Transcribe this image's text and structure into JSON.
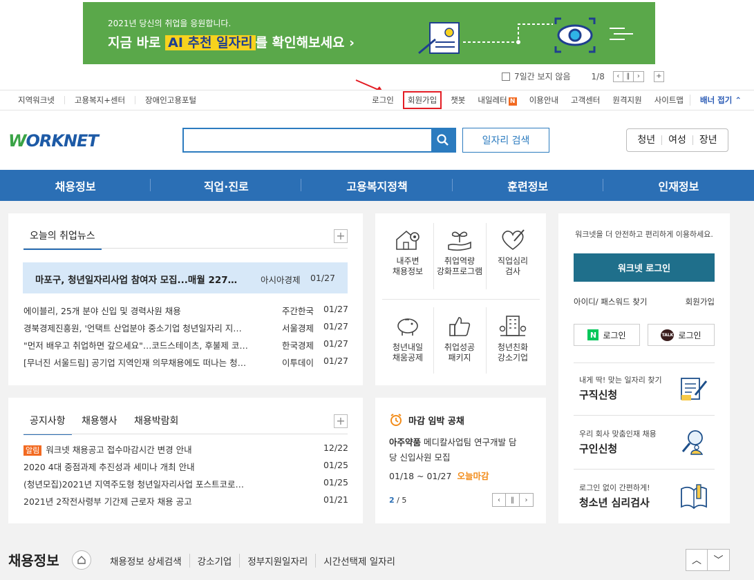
{
  "banner": {
    "sub": "2021년 당신의 취업을 응원합니다.",
    "main_pre": "지금 바로 ",
    "main_hl": "AI 추천 일자리",
    "main_post": "를 확인해보세요 ›",
    "hide_7days": "7일간 보지 않음",
    "page": "1/8"
  },
  "topbar": {
    "left": [
      "지역워크넷",
      "고용복지+센터",
      "장애인고용포털"
    ],
    "login": "로그인",
    "join": "회원가입",
    "chatbot": "챗봇",
    "naeil": "내일레터",
    "naeil_badge": "N",
    "guide": "이용안내",
    "cs": "고객센터",
    "remote": "원격지원",
    "sitemap": "사이트맵",
    "banner_toggle": "배너 접기"
  },
  "header": {
    "logo_w": "W",
    "logo_rest": "ORKNET",
    "job_search": "일자리 검색",
    "quick": [
      "청년",
      "여성",
      "장년"
    ]
  },
  "gnb": [
    "채용정보",
    "직업·진로",
    "고용복지정책",
    "훈련정보",
    "인재정보"
  ],
  "news": {
    "title": "오늘의 취업뉴스",
    "featured": {
      "title": "마포구, 청년일자리사업 참여자 모집...매월 227…",
      "source": "아시아경제",
      "date": "01/27"
    },
    "items": [
      {
        "title": "에이블리, 25개 분야 신입 및 경력사원 채용",
        "source": "주간한국",
        "date": "01/27"
      },
      {
        "title": "경북경제진흥원, '언택트 산업분야 중소기업 청년일자리 지…",
        "source": "서울경제",
        "date": "01/27"
      },
      {
        "title": "\"먼저 배우고 취업하면 갚으세요\"…코드스테이츠, 후불제 코…",
        "source": "한국경제",
        "date": "01/27"
      },
      {
        "title": "[무너진 서울드림] 공기업 지역인재 의무채용에도 떠나는 청…",
        "source": "이투데이",
        "date": "01/27"
      }
    ]
  },
  "services": [
    {
      "l1": "내주변",
      "l2": "채용정보",
      "icon": "house-map-pin-icon"
    },
    {
      "l1": "취업역량",
      "l2": "강화프로그램",
      "icon": "sprout-hand-icon"
    },
    {
      "l1": "직업심리",
      "l2": "검사",
      "icon": "heart-pen-icon"
    },
    {
      "l1": "청년내일",
      "l2": "채움공제",
      "icon": "piggy-bank-icon"
    },
    {
      "l1": "취업성공",
      "l2": "패키지",
      "icon": "thumbs-up-icon"
    },
    {
      "l1": "청년친화",
      "l2": "강소기업",
      "icon": "building-icon"
    }
  ],
  "login_panel": {
    "desc": "워크넷을 더 안전하고 편리하게 이용하세요.",
    "login_btn": "워크넷 로그인",
    "find": "아이디/ 패스워드 찾기",
    "join": "회원가입",
    "naver": "로그인",
    "naver_mark": "N",
    "kakao": "로그인",
    "kakao_mark": "TALK"
  },
  "notice": {
    "tabs": [
      "공지사항",
      "채용행사",
      "채용박람회"
    ],
    "badge": "알림",
    "items": [
      {
        "title": "워크넷 채용공고 접수마감시간 변경 안내",
        "date": "12/22"
      },
      {
        "title": "2020 4대 중점과제 추진성과 세미나 개최 안내",
        "date": "01/25"
      },
      {
        "title": "(청년모집)2021년 지역주도형 청년일자리사업 포스트코로…",
        "date": "01/25"
      },
      {
        "title": "2021년 2작전사령부 기간제 근로자 채용 공고",
        "date": "01/21"
      }
    ]
  },
  "deadline": {
    "title": "마감 임박 공채",
    "company": "아주약품",
    "desc1": "메디칼사업팀 연구개발 담",
    "desc2": "당 신입사원 모집",
    "period": "01/18 ~ 01/27",
    "today": "오늘마감",
    "page_cur": "2",
    "page_sep": " / ",
    "page_total": "5"
  },
  "side": [
    {
      "small": "내게 딱! 맞는 일자리 찾기",
      "big": "구직신청",
      "icon": "resume-pen-icon"
    },
    {
      "small": "우리 회사 맞춤인재 채용",
      "big": "구인신청",
      "icon": "person-search-icon"
    },
    {
      "small": "로그인 없이 간편하게!",
      "big": "청소년 심리검사",
      "icon": "book-pen-icon"
    }
  ],
  "jobinfo": {
    "title": "채용정보",
    "links": [
      "채용정보 상세검색",
      "강소기업",
      "정부지원일자리",
      "시간선택제 일자리"
    ]
  },
  "colors": {
    "primary": "#2b6fb5",
    "accent": "#f26a21",
    "login_btn": "#1f6f8b"
  }
}
